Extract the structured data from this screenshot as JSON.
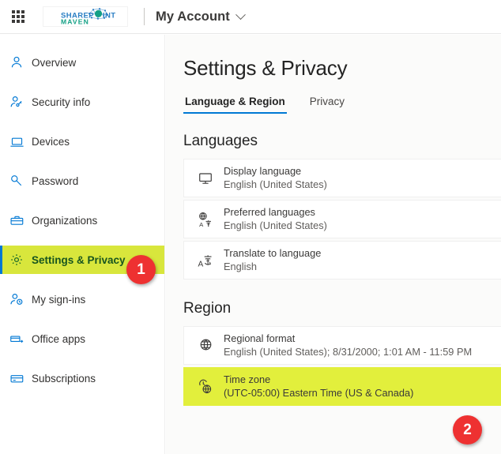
{
  "header": {
    "waffle_icon": "app-launcher-waffle-icon",
    "logo": {
      "line1": "SHAREPOINT",
      "line2": "MAVEN"
    },
    "account_label": "My Account",
    "account_chevron_icon": "chevron-down-icon"
  },
  "sidebar": {
    "items": [
      {
        "label": "Overview",
        "icon": "person-icon",
        "active": false
      },
      {
        "label": "Security info",
        "icon": "person-key-icon",
        "active": false
      },
      {
        "label": "Devices",
        "icon": "laptop-icon",
        "active": false
      },
      {
        "label": "Password",
        "icon": "key-icon",
        "active": false
      },
      {
        "label": "Organizations",
        "icon": "briefcase-icon",
        "active": false
      },
      {
        "label": "Settings & Privacy",
        "icon": "gear-icon",
        "active": true
      },
      {
        "label": "My sign-ins",
        "icon": "person-clock-icon",
        "active": false
      },
      {
        "label": "Office apps",
        "icon": "window-apps-icon",
        "active": false
      },
      {
        "label": "Subscriptions",
        "icon": "card-icon",
        "active": false
      }
    ]
  },
  "main": {
    "title": "Settings & Privacy",
    "tabs": [
      {
        "label": "Language & Region",
        "selected": true
      },
      {
        "label": "Privacy",
        "selected": false
      }
    ],
    "languages": {
      "heading": "Languages",
      "cards": [
        {
          "title": "Display language",
          "value": "English (United States)",
          "icon": "monitor-icon",
          "highlighted": false
        },
        {
          "title": "Preferred languages",
          "value": "English (United States)",
          "icon": "globe-language-icon",
          "highlighted": false
        },
        {
          "title": "Translate to language",
          "value": "English",
          "icon": "translate-icon",
          "highlighted": false
        }
      ]
    },
    "region": {
      "heading": "Region",
      "cards": [
        {
          "title": "Regional format",
          "value": "English (United States); 8/31/2000; 1:01 AM - 11:59 PM",
          "icon": "globe-grid-icon",
          "highlighted": false
        },
        {
          "title": "Time zone",
          "value": "(UTC-05:00) Eastern Time (US & Canada)",
          "icon": "clock-globe-icon",
          "highlighted": true
        }
      ]
    }
  },
  "annotations": [
    {
      "number": "1",
      "target": "sidebar-item-settings-privacy"
    },
    {
      "number": "2",
      "target": "card-time-zone"
    }
  ],
  "colors": {
    "accent_blue": "#0078d4",
    "highlight_yellow": "#e2ef3c",
    "badge_red": "#ee3131",
    "text_primary": "#3b3a39"
  }
}
